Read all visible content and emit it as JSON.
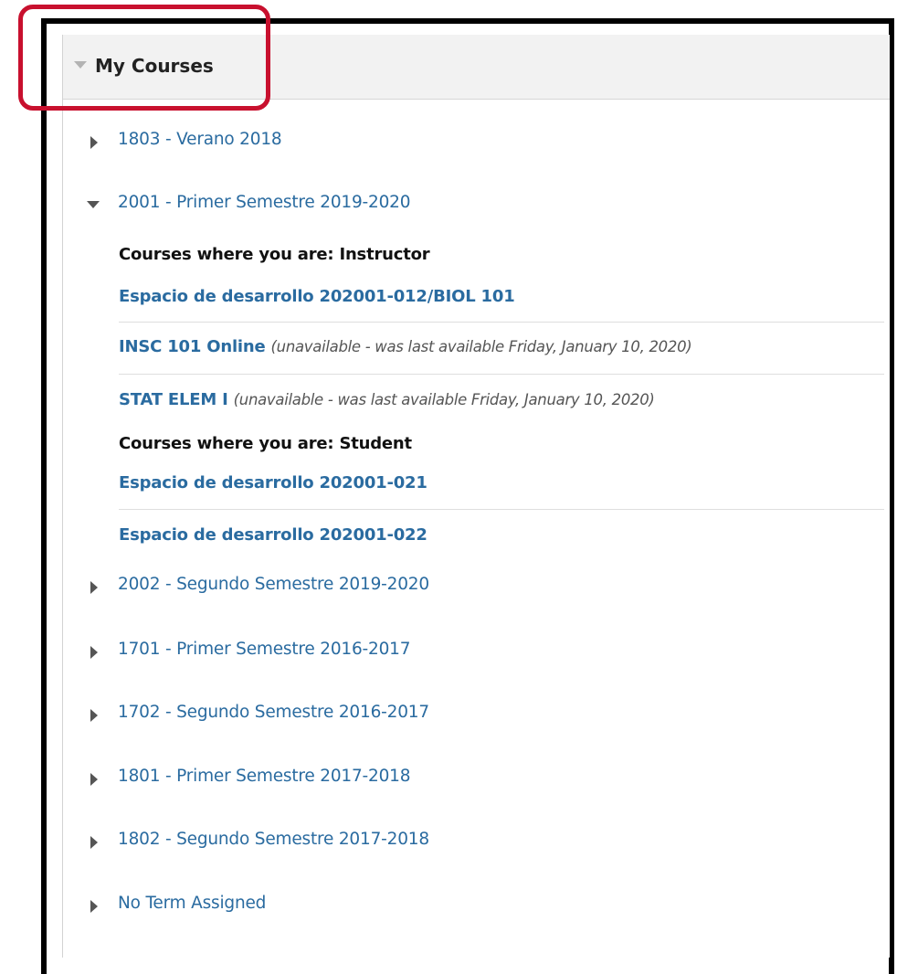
{
  "panel": {
    "title": "My Courses"
  },
  "terms": {
    "t1803": "1803 - Verano 2018",
    "t2001": "2001 - Primer Semestre 2019-2020",
    "t2002": "2002 - Segundo Semestre 2019-2020",
    "t1701": "1701 - Primer Semestre 2016-2017",
    "t1702": "1702 - Segundo Semestre 2016-2017",
    "t1801": "1801 - Primer Semestre 2017-2018",
    "t1802": "1802 - Segundo Semestre 2017-2018",
    "none": "No Term Assigned"
  },
  "expanded_term": {
    "instructor_heading": "Courses where you are: Instructor",
    "student_heading": "Courses where you are: Student",
    "instructor_courses": [
      {
        "name": "Espacio de desarrollo 202001-012/BIOL 101",
        "note": ""
      },
      {
        "name": "INSC 101 Online",
        "note": "(unavailable - was last available Friday, January 10, 2020)"
      },
      {
        "name": "STAT ELEM I",
        "note": "(unavailable - was last available Friday, January 10, 2020)"
      }
    ],
    "student_courses": [
      {
        "name": "Espacio de desarrollo 202001-021",
        "note": ""
      },
      {
        "name": "Espacio de desarrollo 202001-022",
        "note": ""
      }
    ]
  },
  "colors": {
    "link": "#2a6ba0",
    "highlight": "#c8102e",
    "header_bg": "#f2f2f2"
  },
  "icons": {
    "collapsed": "triangle-right-icon",
    "expanded": "triangle-down-icon"
  }
}
